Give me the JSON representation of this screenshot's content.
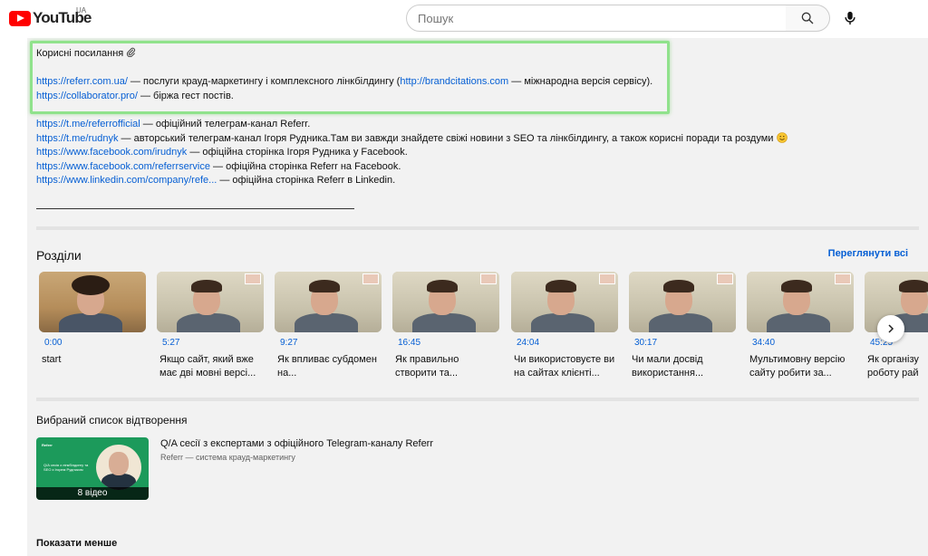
{
  "header": {
    "logo_text": "YouTube",
    "region": "UA",
    "search_placeholder": "Пошук"
  },
  "description": {
    "heading": "Корисні посилання",
    "lines": [
      {
        "link": "https://referr.com.ua/",
        "text": " — послуги крауд-маркетингу і комплексного лінкбілдингу (",
        "link2": "http://brandcitations.com",
        "text2": " — міжнародна версія сервісу)."
      },
      {
        "link": "https://collaborator.pro/",
        "text": " — біржа гест постів."
      },
      {
        "link": "https://t.me/referrofficial",
        "text": " — офіційний телеграм-канал Referr."
      },
      {
        "link": "https://t.me/rudnyk",
        "text": " — авторський телеграм-канал Ігоря Рудника.Там ви завжди знайдете свіжі новини з SEO та лінкбілдингу, а також корисні поради та роздуми"
      },
      {
        "link": "https://www.facebook.com/irudnyk",
        "text": " — офіційна сторінка Ігоря Рудника у Facebook."
      },
      {
        "link": "https://www.facebook.com/referrservice",
        "text": " — офіційна сторінка Referr на Facebook."
      },
      {
        "link": "https://www.linkedin.com/company/refe...",
        "text": " — офіційна сторінка Referr в Linkedin."
      }
    ]
  },
  "chapters": {
    "title": "Розділи",
    "see_all": "Переглянути всі",
    "items": [
      {
        "time": "0:00",
        "title": "start"
      },
      {
        "time": "5:27",
        "title": "Якщо сайт, який вже має дві мовні версі..."
      },
      {
        "time": "9:27",
        "title": "Як впливає субдомен на..."
      },
      {
        "time": "16:45",
        "title": "Як правильно створити та..."
      },
      {
        "time": "24:04",
        "title": "Чи використовуєте ви на сайтах клієнті..."
      },
      {
        "time": "30:17",
        "title": "Чи мали досвід використання..."
      },
      {
        "time": "34:40",
        "title": "Мультимовну версію сайту робити за..."
      },
      {
        "time": "45:25",
        "title": "Як організу роботу рай"
      }
    ]
  },
  "playlist": {
    "section_title": "Вибраний список відтворення",
    "title": "Q/A сесії з експертами з офіційного Telegram-каналу Referr",
    "channel": "Referr — система крауд-маркетингу",
    "count": "8 відео",
    "thumb_brand": "Referr",
    "thumb_text": "Q/A сесія з лінкбілдингу та SEO з Ігорем Рудником"
  },
  "show_less": "Показати менше"
}
